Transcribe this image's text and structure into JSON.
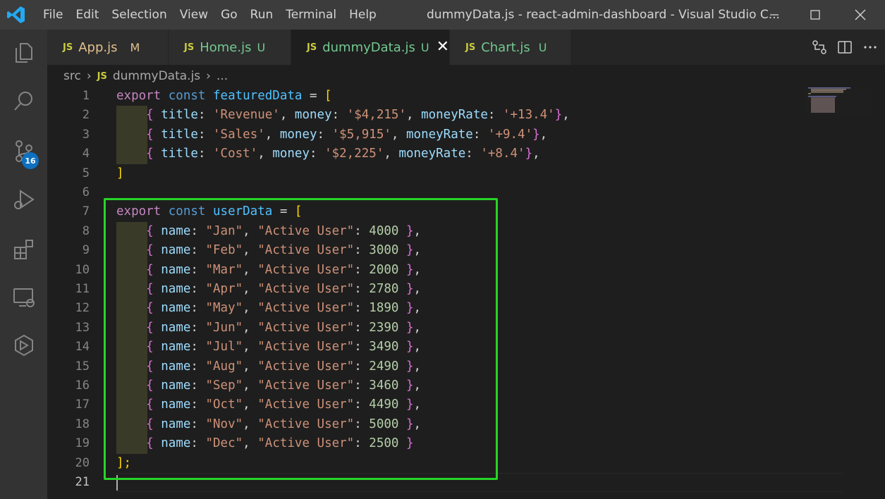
{
  "window": {
    "title": "dummyData.js - react-admin-dashboard - Visual Studio C..."
  },
  "menu": [
    "File",
    "Edit",
    "Selection",
    "View",
    "Go",
    "Run",
    "Terminal",
    "Help"
  ],
  "activity": {
    "source_control_badge": "16"
  },
  "tabs": [
    {
      "label": "App.js",
      "status": "M",
      "icon": "JS"
    },
    {
      "label": "Home.js",
      "status": "U",
      "icon": "JS"
    },
    {
      "label": "dummyData.js",
      "status": "U",
      "icon": "JS",
      "active": true
    },
    {
      "label": "Chart.js",
      "status": "U",
      "icon": "JS"
    }
  ],
  "breadcrumb": {
    "folder": "src",
    "file_icon": "JS",
    "file": "dummyData.js",
    "more": "..."
  },
  "editor": {
    "line_numbers": [
      "1",
      "2",
      "3",
      "4",
      "5",
      "6",
      "7",
      "8",
      "9",
      "10",
      "11",
      "12",
      "13",
      "14",
      "15",
      "16",
      "17",
      "18",
      "19",
      "20",
      "21"
    ],
    "featured": {
      "decl": {
        "export": "export",
        "const": "const",
        "name": "featuredData",
        "eq": " = ",
        "open": "["
      },
      "rows": [
        {
          "title": "'Revenue'",
          "money": "'$4,215'",
          "rate": "'+13.4'"
        },
        {
          "title": "'Sales'",
          "money": "'$5,915'",
          "rate": "'+9.4'"
        },
        {
          "title": "'Cost'",
          "money": "'$2,225'",
          "rate": "'+8.4'"
        }
      ],
      "close": "]"
    },
    "user": {
      "decl": {
        "export": "export",
        "const": "const",
        "name": "userData",
        "eq": " = ",
        "open": "["
      },
      "rows": [
        {
          "name": "\"Jan\"",
          "value": "4000"
        },
        {
          "name": "\"Feb\"",
          "value": "3000"
        },
        {
          "name": "\"Mar\"",
          "value": "2000"
        },
        {
          "name": "\"Apr\"",
          "value": "2780"
        },
        {
          "name": "\"May\"",
          "value": "1890"
        },
        {
          "name": "\"Jun\"",
          "value": "2390"
        },
        {
          "name": "\"Jul\"",
          "value": "3490"
        },
        {
          "name": "\"Aug\"",
          "value": "2490"
        },
        {
          "name": "\"Sep\"",
          "value": "3460"
        },
        {
          "name": "\"Oct\"",
          "value": "4490"
        },
        {
          "name": "\"Nov\"",
          "value": "5000"
        },
        {
          "name": "\"Dec\"",
          "value": "2500"
        }
      ],
      "close": "];"
    },
    "keys": {
      "title": "title",
      "money": "money",
      "moneyRate": "moneyRate",
      "name": "name",
      "active_user": "\"Active User\""
    }
  },
  "colors": {
    "highlight_box": "#28d428",
    "accent": "#0e70c0"
  }
}
